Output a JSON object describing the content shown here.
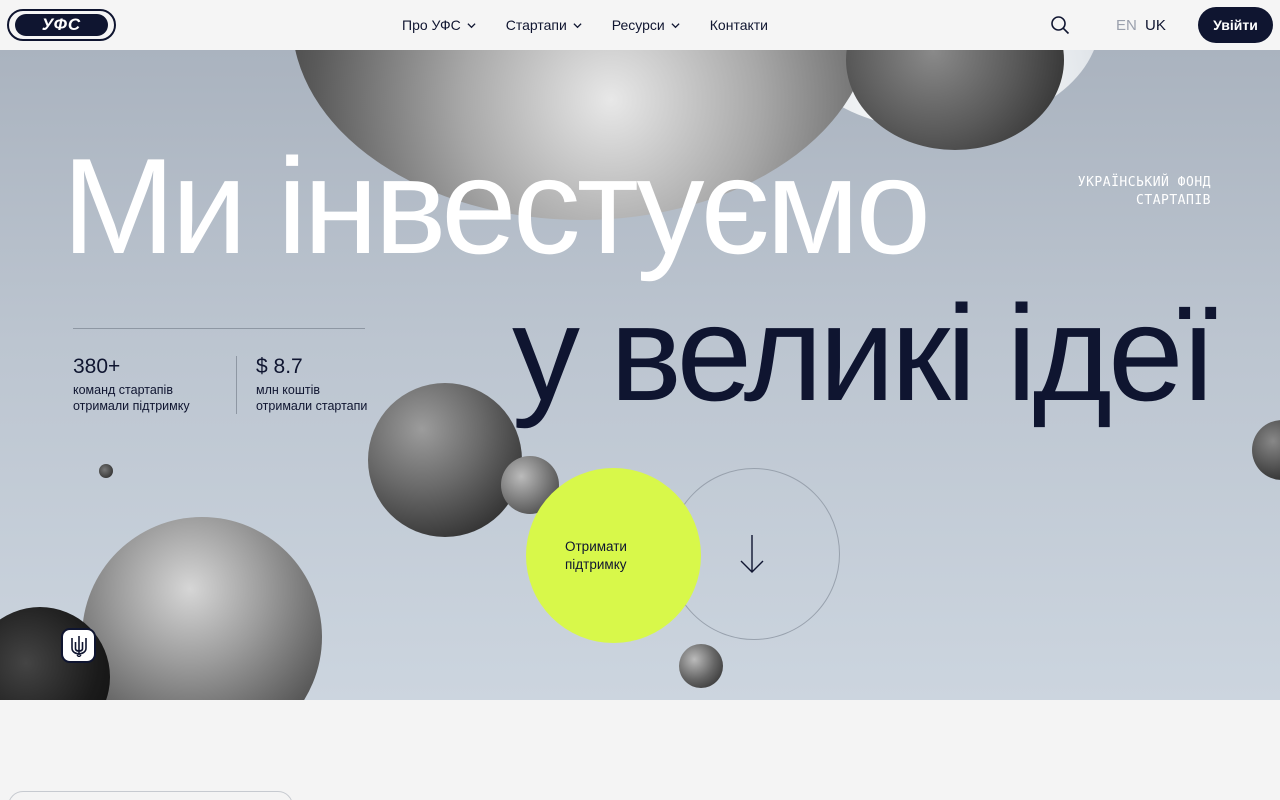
{
  "header": {
    "logo_text": "УФС",
    "nav": [
      {
        "label": "Про УФС",
        "has_dropdown": true
      },
      {
        "label": "Стартапи",
        "has_dropdown": true
      },
      {
        "label": "Ресурси",
        "has_dropdown": true
      },
      {
        "label": "Контакти",
        "has_dropdown": false
      }
    ],
    "search_icon": "search-icon",
    "lang": {
      "en": "EN",
      "uk": "UK",
      "active": "UK"
    },
    "login_label": "Увійти"
  },
  "hero": {
    "line1": "Ми інвестуємо",
    "line2": "у великі ідеї",
    "tagline_1": "УКРАЇНСЬКИЙ ФОНД",
    "tagline_2": "СТАРТАПІВ",
    "stats": [
      {
        "value": "380+",
        "text_1": "команд стартапів",
        "text_2": "отримали підтримку"
      },
      {
        "value": "$ 8.7",
        "text_1": "млн коштів",
        "text_2": "отримали стартапи"
      }
    ],
    "cta_line1": "Отримати",
    "cta_line2": "підтримку",
    "scroll_icon": "arrow-down-icon",
    "badge_icon": "trident-icon"
  },
  "colors": {
    "navy": "#0f1530",
    "accent_lime": "#d8f84a",
    "hero_bg": "#bcc5d0"
  }
}
